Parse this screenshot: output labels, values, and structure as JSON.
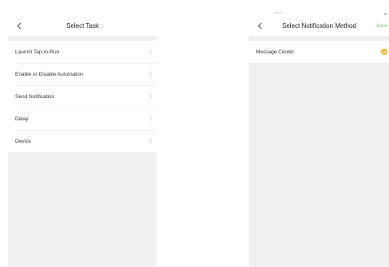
{
  "left_screen": {
    "title": "Select Task",
    "back_icon": "chevron-left-icon",
    "items": [
      {
        "label": "Launch Tap-to-Run",
        "icon": "chevron-right-icon"
      },
      {
        "label": "Enable or Disable Automation",
        "icon": "chevron-right-icon"
      },
      {
        "label": "Send Notification",
        "icon": "chevron-right-icon"
      },
      {
        "label": "Delay",
        "icon": "chevron-right-icon"
      },
      {
        "label": "Device",
        "icon": "chevron-right-icon"
      }
    ]
  },
  "right_screen": {
    "title": "Select Notification Method",
    "back_icon": "chevron-left-icon",
    "action_label": "Next",
    "items": [
      {
        "label": "Message Center",
        "icon": "check-circle-icon",
        "selected": true
      }
    ]
  },
  "colors": {
    "accent_green": "#7cc36c",
    "check_yellow": "#f3b82a",
    "background_gray": "#f0f0f0",
    "chevron_gray": "#c8c8c8"
  }
}
